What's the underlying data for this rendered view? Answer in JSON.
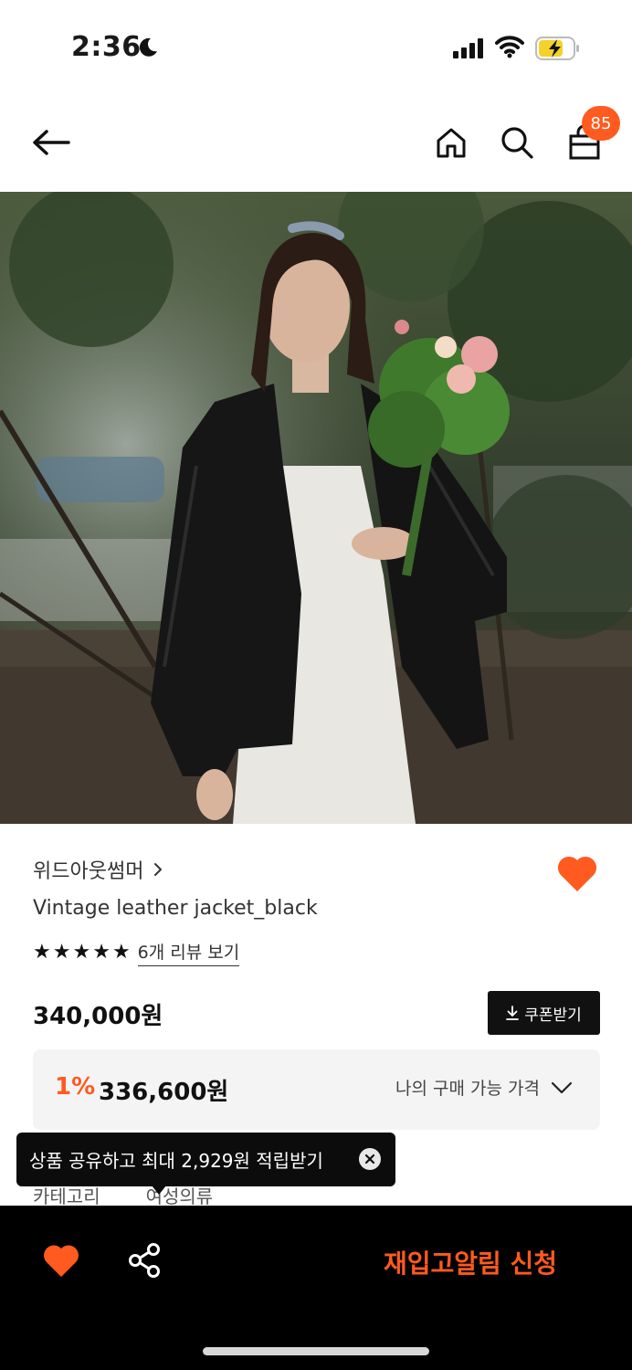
{
  "status_bar": {
    "time": "2:36"
  },
  "nav": {
    "cart_count": "85"
  },
  "product": {
    "brand": "위드아웃썸머",
    "name": "Vintage leather jacket_black",
    "rating_stars": 5,
    "review_link": "6개 리뷰 보기",
    "price": "340,000원",
    "coupon_label": "쿠폰받기",
    "discount_rate": "1%",
    "discount_price": "336,600원",
    "my_price_label": "나의 구매 가능 가격",
    "category_label": "카테고리",
    "category_value": "여성의류"
  },
  "tooltip": {
    "text": "상품 공유하고 최대 2,929원 적립받기"
  },
  "bottom_bar": {
    "restock_label": "재입고알림 신청"
  },
  "colors": {
    "accent": "#ff5a1f",
    "dark": "#000000",
    "price_box": "#f4f4f5"
  }
}
